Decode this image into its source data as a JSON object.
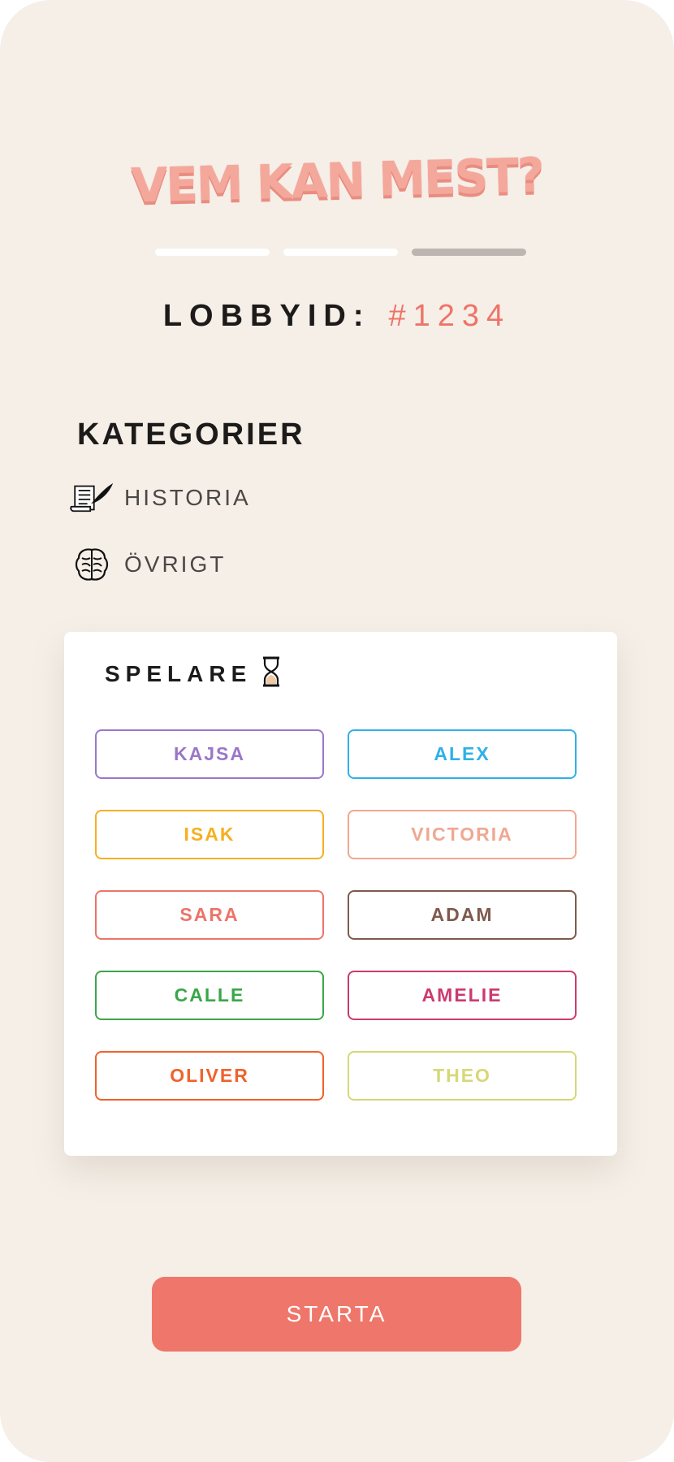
{
  "title": "VEM KAN MEST?",
  "progress": {
    "steps": 3,
    "current": 3
  },
  "lobby": {
    "label": "LOBBYID:",
    "id": "#1234"
  },
  "categories": {
    "heading": "KATEGORIER",
    "items": [
      {
        "label": "HISTORIA",
        "icon": "scroll-quill-icon"
      },
      {
        "label": "ÖVRIGT",
        "icon": "brain-icon"
      }
    ]
  },
  "players_card": {
    "heading": "SPELARE",
    "status_icon": "hourglass-icon",
    "players": [
      {
        "name": "KAJSA",
        "color": "#9a77c9"
      },
      {
        "name": "ALEX",
        "color": "#2fb0ea"
      },
      {
        "name": "ISAK",
        "color": "#f5b021"
      },
      {
        "name": "VICTORIA",
        "color": "#f1a791"
      },
      {
        "name": "SARA",
        "color": "#ec7468"
      },
      {
        "name": "ADAM",
        "color": "#7e5a4c"
      },
      {
        "name": "CALLE",
        "color": "#3ba64a"
      },
      {
        "name": "AMELIE",
        "color": "#cc3a6f"
      },
      {
        "name": "OLIVER",
        "color": "#f0622b"
      },
      {
        "name": "THEO",
        "color": "#d6d877"
      }
    ]
  },
  "start_button": {
    "label": "STARTA",
    "color": "#ef766a"
  }
}
